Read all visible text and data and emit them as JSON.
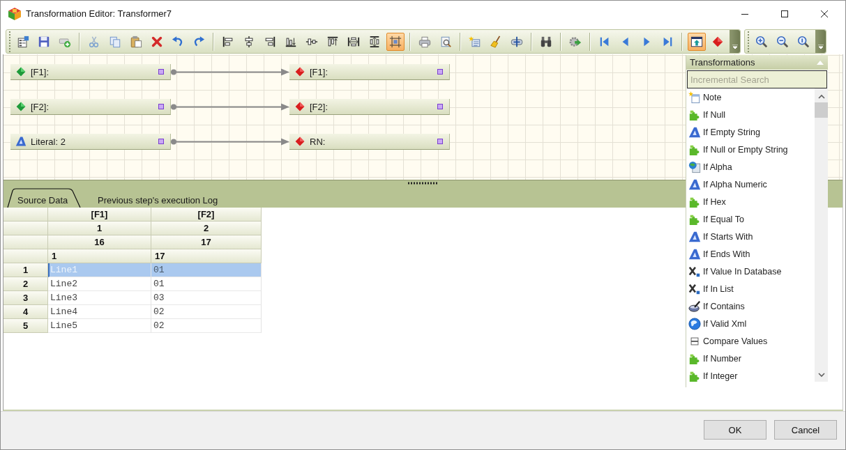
{
  "window": {
    "title": "Transformation Editor: Transformer7"
  },
  "toolbars": [
    {
      "sections": [
        [
          {
            "kind": "properties",
            "pressed": false
          },
          {
            "kind": "save",
            "pressed": false
          },
          {
            "kind": "addrow",
            "pressed": false
          }
        ],
        [
          {
            "kind": "cut",
            "pressed": false
          },
          {
            "kind": "copy",
            "pressed": false
          },
          {
            "kind": "paste",
            "pressed": false
          },
          {
            "kind": "delete",
            "pressed": false
          },
          {
            "kind": "undo",
            "pressed": false
          },
          {
            "kind": "redo",
            "pressed": false
          }
        ],
        [
          {
            "kind": "alignleft",
            "pressed": false
          },
          {
            "kind": "aligncenter",
            "pressed": false
          },
          {
            "kind": "alignright",
            "pressed": false
          },
          {
            "kind": "alignbottom",
            "pressed": false
          },
          {
            "kind": "alignmiddle",
            "pressed": false
          },
          {
            "kind": "aligntop",
            "pressed": false
          },
          {
            "kind": "samewidth",
            "pressed": false
          },
          {
            "kind": "sameheight",
            "pressed": false
          },
          {
            "kind": "fit",
            "pressed": true
          }
        ],
        [
          {
            "kind": "print",
            "pressed": false
          },
          {
            "kind": "preview",
            "pressed": false
          }
        ],
        [
          {
            "kind": "newrule",
            "pressed": false
          },
          {
            "kind": "clean",
            "pressed": false
          },
          {
            "kind": "link",
            "pressed": false
          }
        ],
        [
          {
            "kind": "find",
            "pressed": false
          }
        ],
        [
          {
            "kind": "run",
            "pressed": false
          }
        ],
        [
          {
            "kind": "first",
            "pressed": false
          },
          {
            "kind": "previous",
            "pressed": false
          },
          {
            "kind": "next",
            "pressed": false
          },
          {
            "kind": "last",
            "pressed": false
          }
        ],
        [
          {
            "kind": "panel",
            "pressed": true
          },
          {
            "kind": "target",
            "pressed": false
          }
        ]
      ]
    },
    {
      "sections": [
        [
          {
            "kind": "zoomin",
            "pressed": false
          },
          {
            "kind": "zoomout",
            "pressed": false
          },
          {
            "kind": "zoomreset",
            "pressed": false
          }
        ]
      ]
    }
  ],
  "canvas": {
    "mappings": [
      {
        "source": {
          "kind": "field",
          "label": "[F1]:"
        },
        "target": {
          "label": "[F1]:"
        }
      },
      {
        "source": {
          "kind": "field",
          "label": "[F2]:"
        },
        "target": {
          "label": "[F2]:"
        }
      },
      {
        "source": {
          "kind": "literal",
          "label": "Literal: 2"
        },
        "target": {
          "label": "RN:"
        }
      }
    ]
  },
  "tabs": [
    {
      "label": "Source Data",
      "selected": true
    },
    {
      "label": "Previous step's execution Log",
      "selected": false
    }
  ],
  "table": {
    "header_rows": [
      {
        "kind": "title",
        "cells": [
          "[F1]",
          "[F2]"
        ]
      },
      {
        "kind": "title",
        "cells": [
          "1",
          "2"
        ]
      },
      {
        "kind": "title",
        "cells": [
          "16",
          "17"
        ]
      },
      {
        "kind": "entry",
        "cells": [
          "1",
          "17"
        ]
      }
    ],
    "rows": [
      {
        "number": "1",
        "cells": [
          "Line1",
          "01"
        ],
        "selected": true
      },
      {
        "number": "2",
        "cells": [
          "Line2",
          "01"
        ],
        "selected": false
      },
      {
        "number": "3",
        "cells": [
          "Line3",
          "03"
        ],
        "selected": false
      },
      {
        "number": "4",
        "cells": [
          "Line4",
          "02"
        ],
        "selected": false
      },
      {
        "number": "5",
        "cells": [
          "Line5",
          "02"
        ],
        "selected": false
      }
    ]
  },
  "transformations": {
    "title": "Transformations",
    "search": {
      "placeholder": "Incremental Search"
    },
    "items": [
      {
        "kind": "note",
        "label": "Note"
      },
      {
        "kind": "plugin",
        "label": "If Null"
      },
      {
        "kind": "string",
        "label": "If Empty String"
      },
      {
        "kind": "plugin",
        "label": "If Null or Empty String"
      },
      {
        "kind": "web",
        "label": "If Alpha"
      },
      {
        "kind": "string",
        "label": "If Alpha Numeric"
      },
      {
        "kind": "plugin",
        "label": "If Hex"
      },
      {
        "kind": "plugin",
        "label": "If Equal To"
      },
      {
        "kind": "string",
        "label": "If Starts With"
      },
      {
        "kind": "string",
        "label": "If Ends With"
      },
      {
        "kind": "lookup",
        "label": "If Value In Database"
      },
      {
        "kind": "lookup",
        "label": "If In List"
      },
      {
        "kind": "contains",
        "label": "If Contains"
      },
      {
        "kind": "xml",
        "label": "If Valid Xml"
      },
      {
        "kind": "compare",
        "label": "Compare Values"
      },
      {
        "kind": "plugin",
        "label": "If Number"
      },
      {
        "kind": "plugin",
        "label": "If Integer"
      }
    ]
  },
  "buttons": [
    "OK",
    "Cancel"
  ]
}
